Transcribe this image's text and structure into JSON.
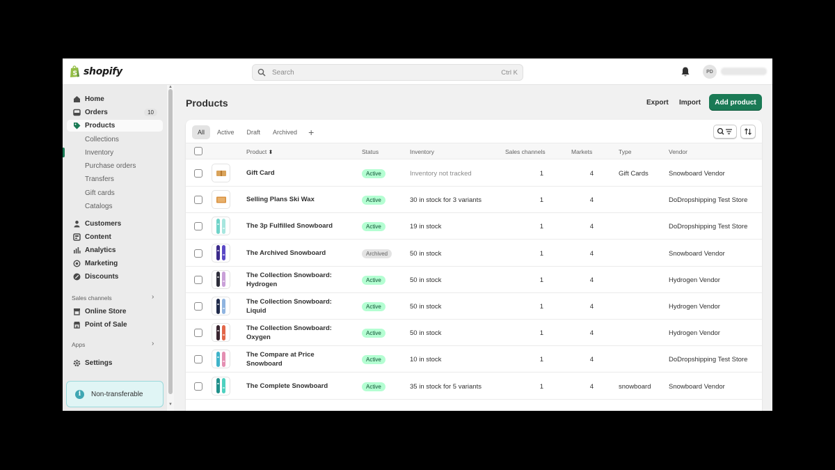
{
  "topbar": {
    "logo_text": "shopify",
    "search_placeholder": "Search",
    "search_shortcut": "Ctrl K",
    "avatar_initials": "PD"
  },
  "sidebar": {
    "nav": [
      {
        "label": "Home",
        "icon": "home-icon"
      },
      {
        "label": "Orders",
        "icon": "orders-icon",
        "badge": "10"
      },
      {
        "label": "Products",
        "icon": "tag-icon",
        "active": true
      }
    ],
    "product_subitems": [
      "Collections",
      "Inventory",
      "Purchase orders",
      "Transfers",
      "Gift cards",
      "Catalogs"
    ],
    "nav2": [
      {
        "label": "Customers",
        "icon": "person-icon"
      },
      {
        "label": "Content",
        "icon": "content-icon"
      },
      {
        "label": "Analytics",
        "icon": "chart-icon"
      },
      {
        "label": "Marketing",
        "icon": "target-icon"
      },
      {
        "label": "Discounts",
        "icon": "discount-icon"
      }
    ],
    "sales_channels_label": "Sales channels",
    "channels": [
      {
        "label": "Online Store",
        "icon": "store-icon"
      },
      {
        "label": "Point of Sale",
        "icon": "pos-icon"
      }
    ],
    "apps_label": "Apps",
    "settings_label": "Settings",
    "nontransferable_label": "Non-transferable"
  },
  "main": {
    "title": "Products",
    "export_label": "Export",
    "import_label": "Import",
    "add_product_label": "Add product",
    "tabs": [
      "All",
      "Active",
      "Draft",
      "Archived"
    ],
    "columns": [
      "Product",
      "Status",
      "Inventory",
      "Sales channels",
      "Markets",
      "Type",
      "Vendor"
    ],
    "rows": [
      {
        "name": "Gift Card",
        "status": "Active",
        "inventory": "Inventory not tracked",
        "inventory_muted": true,
        "channels": "1",
        "markets": "4",
        "type": "Gift Cards",
        "vendor": "Snowboard Vendor",
        "thumb": "gift"
      },
      {
        "name": "Selling Plans Ski Wax",
        "status": "Active",
        "inventory": "30 in stock for 3 variants",
        "channels": "1",
        "markets": "4",
        "type": "",
        "vendor": "DoDropshipping Test Store",
        "thumb": "wax"
      },
      {
        "name": "The 3p Fulfilled Snowboard",
        "status": "Active",
        "inventory": "19 in stock",
        "channels": "1",
        "markets": "4",
        "type": "",
        "vendor": "DoDropshipping Test Store",
        "thumb": "board-teal"
      },
      {
        "name": "The Archived Snowboard",
        "status": "Archived",
        "inventory": "50 in stock",
        "channels": "1",
        "markets": "4",
        "type": "",
        "vendor": "Snowboard Vendor",
        "thumb": "board-purple"
      },
      {
        "name": "The Collection Snowboard: Hydrogen",
        "status": "Active",
        "inventory": "50 in stock",
        "channels": "1",
        "markets": "4",
        "type": "",
        "vendor": "Hydrogen Vendor",
        "thumb": "board-dark"
      },
      {
        "name": "The Collection Snowboard: Liquid",
        "status": "Active",
        "inventory": "50 in stock",
        "channels": "1",
        "markets": "4",
        "type": "",
        "vendor": "Hydrogen Vendor",
        "thumb": "board-navy"
      },
      {
        "name": "The Collection Snowboard: Oxygen",
        "status": "Active",
        "inventory": "50 in stock",
        "channels": "1",
        "markets": "4",
        "type": "",
        "vendor": "Hydrogen Vendor",
        "thumb": "board-red"
      },
      {
        "name": "The Compare at Price Snowboard",
        "status": "Active",
        "inventory": "10 in stock",
        "channels": "1",
        "markets": "4",
        "type": "",
        "vendor": "DoDropshipping Test Store",
        "thumb": "board-pink"
      },
      {
        "name": "The Complete Snowboard",
        "status": "Active",
        "inventory": "35 in stock for 5 variants",
        "channels": "1",
        "markets": "4",
        "type": "snowboard",
        "vendor": "Snowboard Vendor",
        "thumb": "board-teal2"
      }
    ],
    "colors": {
      "accent": "#1a7a55",
      "active_badge": "#b4fed2",
      "archived_badge": "#e3e3e3"
    }
  }
}
